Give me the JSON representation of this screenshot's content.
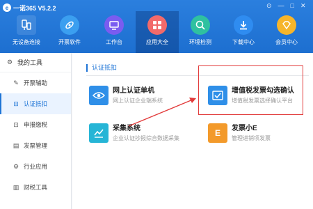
{
  "app": {
    "title": "一诺365 V5.2.2",
    "logo_text": "e"
  },
  "window_controls": {
    "pin": "⊙",
    "minimize": "—",
    "maximize": "□",
    "close": "✕"
  },
  "nav": [
    {
      "label": "无设备连接",
      "icon": "usb-device-icon",
      "color": "#1e74d6"
    },
    {
      "label": "开票软件",
      "icon": "invoice-software-icon",
      "color": "#3b9ff0"
    },
    {
      "label": "工作台",
      "icon": "workbench-icon",
      "color": "#7a5cf0"
    },
    {
      "label": "应用大全",
      "icon": "apps-icon",
      "color": "#f26a6a"
    },
    {
      "label": "环境检测",
      "icon": "environment-check-icon",
      "color": "#2fc1a0"
    },
    {
      "label": "下载中心",
      "icon": "download-icon",
      "color": "#2f8cf0"
    },
    {
      "label": "会员中心",
      "icon": "vip-diamond-icon",
      "color": "#f6b52b"
    }
  ],
  "sidebar": {
    "header": "我的工具",
    "items": [
      {
        "label": "开票辅助",
        "icon": "edit-icon"
      },
      {
        "label": "认证抵扣",
        "icon": "tag-icon"
      },
      {
        "label": "申报缴税",
        "icon": "declare-icon"
      },
      {
        "label": "发票管理",
        "icon": "invoice-manage-icon"
      },
      {
        "label": "行业应用",
        "icon": "industry-icon"
      },
      {
        "label": "财税工具",
        "icon": "tax-tool-icon"
      }
    ]
  },
  "main": {
    "section_title": "认证抵扣",
    "cards": [
      {
        "title": "网上认证单机",
        "desc": "网上认证企业端系统",
        "icon": "eye-icon",
        "glyph": "◉",
        "color": "#2f8fe8"
      },
      {
        "title": "增值税发票勾选确认",
        "desc": "增值税发票选择确认平台",
        "icon": "checkbox-confirm-icon",
        "glyph": "✓",
        "color": "#2f8fe8"
      },
      {
        "title": "采集系统",
        "desc": "企业认证抄报综合数据采集",
        "icon": "collect-icon",
        "glyph": "⇄",
        "color": "#26b5d6"
      },
      {
        "title": "发票小E",
        "desc": "管理进销项发票",
        "icon": "invoice-e-icon",
        "glyph": "E",
        "color": "#f39a2b"
      }
    ]
  }
}
